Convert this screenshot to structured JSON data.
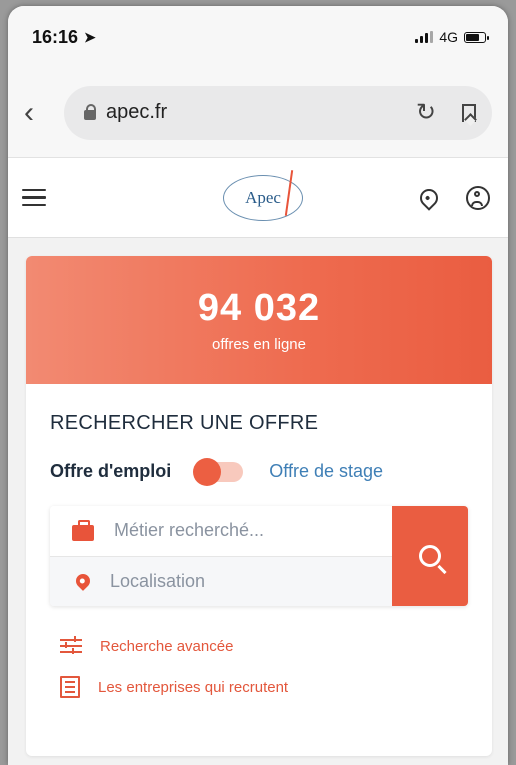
{
  "status_bar": {
    "time": "16:16",
    "network": "4G"
  },
  "browser": {
    "url": "apec.fr",
    "icons": [
      "back-chevron-icon",
      "lock-icon",
      "reload-icon",
      "bookmark-icon"
    ]
  },
  "site_header": {
    "logo_text": "Apec",
    "icons": [
      "menu-icon",
      "location-pin-icon",
      "user-account-icon"
    ]
  },
  "banner": {
    "count": "94 032",
    "subtitle": "offres en ligne"
  },
  "search": {
    "title": "RECHERCHER UNE OFFRE",
    "option_left": "Offre d'emploi",
    "option_right": "Offre de stage",
    "job_placeholder": "Métier recherché...",
    "location_placeholder": "Localisation"
  },
  "links": {
    "advanced": "Recherche avancée",
    "companies": "Les entreprises qui recrutent"
  },
  "colors": {
    "accent": "#ea5d41",
    "link_blue": "#3f7fb6",
    "title": "#1f2d3d"
  }
}
